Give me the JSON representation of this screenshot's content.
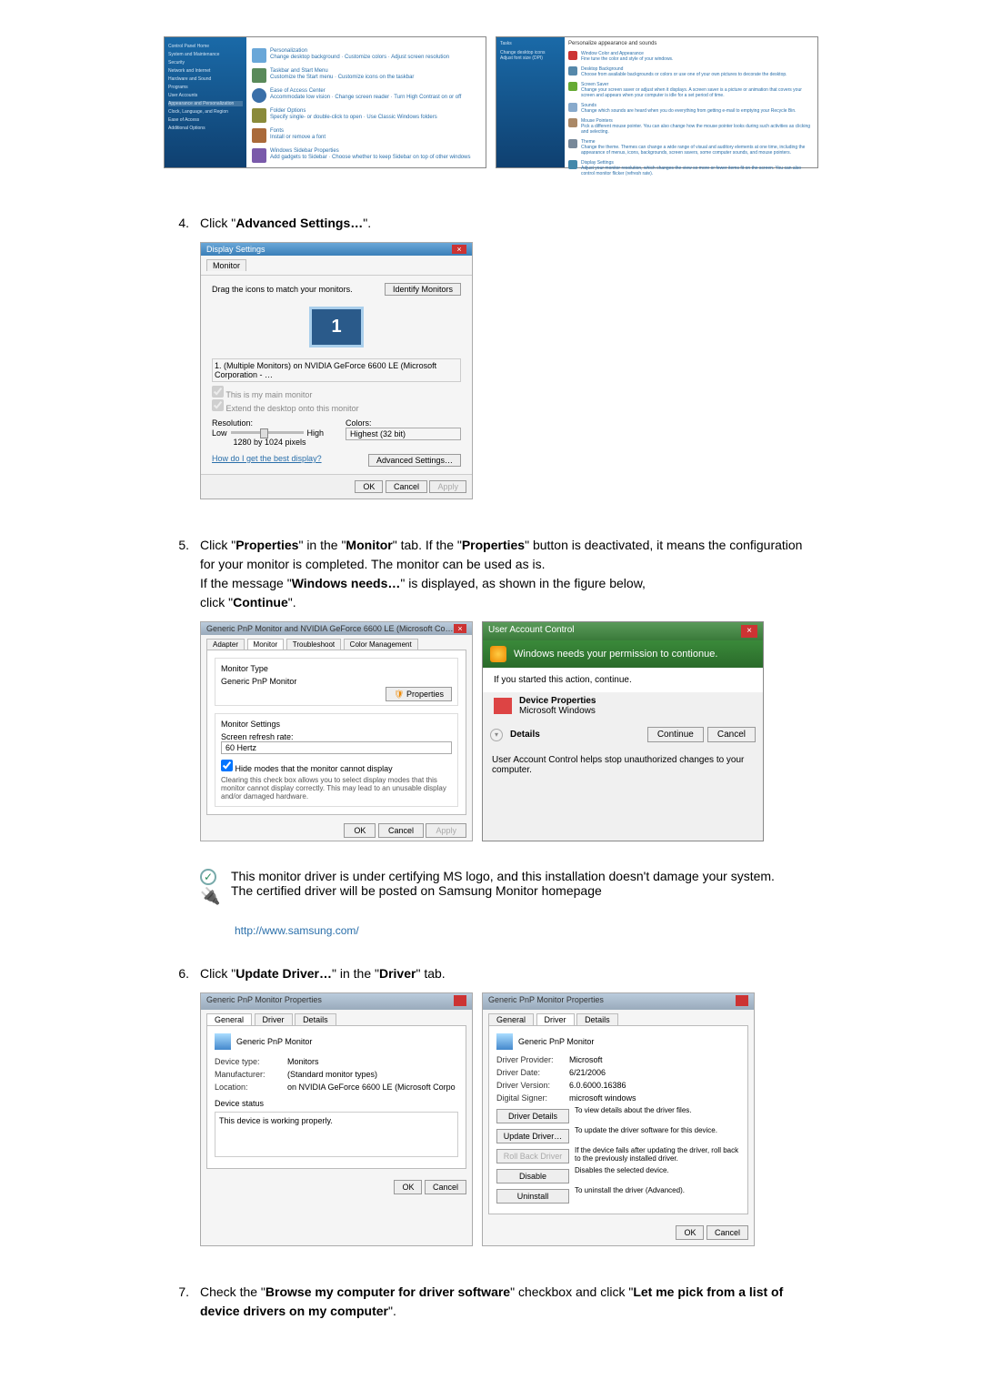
{
  "steps": {
    "s4": {
      "num": "4.",
      "text_pre": "Click \"",
      "text_bold": "Advanced Settings…",
      "text_post": "\"."
    },
    "s5": {
      "num": "5.",
      "p1_seg1": "Click \"",
      "p1_b1": "Properties",
      "p1_seg2": "\" in the \"",
      "p1_b2": "Monitor",
      "p1_seg3": "\" tab. If the \"",
      "p1_b3": "Properties",
      "p1_seg4": "\" button is deactivated, it means the configuration for your monitor is completed. The monitor can be used as is.",
      "p2_seg1": "If the message \"",
      "p2_b1": "Windows needs…",
      "p2_seg2": "\" is displayed, as shown in the figure below,",
      "p3_seg1": "click \"",
      "p3_b1": "Continue",
      "p3_seg2": "\"."
    },
    "s6": {
      "num": "6.",
      "seg1": "Click \"",
      "b1": "Update Driver…",
      "seg2": "\" in the \"",
      "b2": "Driver",
      "seg3": "\" tab."
    },
    "s7": {
      "num": "7.",
      "seg1": "Check the \"",
      "b1": "Browse my computer for driver software",
      "seg2": "\" checkbox and click \"",
      "b2": "Let me pick from a list of device drivers on my computer",
      "seg3": "\"."
    }
  },
  "note": {
    "line1": "This monitor driver is under certifying MS logo, and this installation doesn't damage your system.",
    "line2": "The certified driver will be posted on Samsung Monitor homepage"
  },
  "samsung_url": "http://www.samsung.com/",
  "display_settings": {
    "title": "Display Settings",
    "tab": "Monitor",
    "drag_label": "Drag the icons to match your monitors.",
    "identify_btn": "Identify Monitors",
    "monitor_num": "1",
    "gpu": "1. (Multiple Monitors) on NVIDIA GeForce 6600 LE (Microsoft Corporation - …",
    "chk1": "This is my main monitor",
    "chk2": "Extend the desktop onto this monitor",
    "res_label": "Resolution:",
    "res_low": "Low",
    "res_high": "High",
    "res_val": "1280 by 1024 pixels",
    "colors_label": "Colors:",
    "colors_val": "Highest (32 bit)",
    "help_link": "How do I get the best display?",
    "adv_btn": "Advanced Settings…",
    "ok": "OK",
    "cancel": "Cancel",
    "apply": "Apply"
  },
  "monitor_props": {
    "title": "Generic PnP Monitor and NVIDIA GeForce 6600 LE (Microsoft Co…",
    "tab_adapter": "Adapter",
    "tab_monitor": "Monitor",
    "tab_troubleshoot": "Troubleshoot",
    "tab_color": "Color Management",
    "mon_type": "Monitor Type",
    "mon_name": "Generic PnP Monitor",
    "props_btn": "Properties",
    "settings_h": "Monitor Settings",
    "refresh_label": "Screen refresh rate:",
    "refresh_val": "60 Hertz",
    "hide_chk": "Hide modes that the monitor cannot display",
    "hide_desc": "Clearing this check box allows you to select display modes that this monitor cannot display correctly. This may lead to an unusable display and/or damaged hardware.",
    "ok": "OK",
    "cancel": "Cancel",
    "apply": "Apply"
  },
  "uac": {
    "title": "User Account Control",
    "heading": "Windows needs your permission to contionue.",
    "sub": "If you started this action, continue.",
    "prog1": "Device Properties",
    "prog2": "Microsoft Windows",
    "details": "Details",
    "continue": "Continue",
    "cancel": "Cancel",
    "footer": "User Account Control helps stop unauthorized changes to your computer."
  },
  "pnp_general": {
    "title": "Generic PnP Monitor Properties",
    "tab_general": "General",
    "tab_driver": "Driver",
    "tab_details": "Details",
    "name": "Generic PnP Monitor",
    "devtype_l": "Device type:",
    "devtype_v": "Monitors",
    "mfr_l": "Manufacturer:",
    "mfr_v": "(Standard monitor types)",
    "loc_l": "Location:",
    "loc_v": "on NVIDIA GeForce 6600 LE (Microsoft Corpo",
    "status_h": "Device status",
    "status_v": "This device is working properly.",
    "ok": "OK",
    "cancel": "Cancel"
  },
  "pnp_driver": {
    "title": "Generic PnP Monitor Properties",
    "tab_general": "General",
    "tab_driver": "Driver",
    "tab_details": "Details",
    "name": "Generic PnP Monitor",
    "prov_l": "Driver Provider:",
    "prov_v": "Microsoft",
    "date_l": "Driver Date:",
    "date_v": "6/21/2006",
    "ver_l": "Driver Version:",
    "ver_v": "6.0.6000.16386",
    "sig_l": "Digital Signer:",
    "sig_v": "microsoft windows",
    "btn_details": "Driver Details",
    "btn_details_desc": "To view details about the driver files.",
    "btn_update": "Update Driver…",
    "btn_update_desc": "To update the driver software for this device.",
    "btn_rollback": "Roll Back Driver",
    "btn_rollback_desc": "If the device fails after updating the driver, roll back to the previously installed driver.",
    "btn_disable": "Disable",
    "btn_disable_desc": "Disables the selected device.",
    "btn_uninstall": "Uninstall",
    "btn_uninstall_desc": "To uninstall the driver (Advanced).",
    "ok": "OK",
    "cancel": "Cancel"
  }
}
